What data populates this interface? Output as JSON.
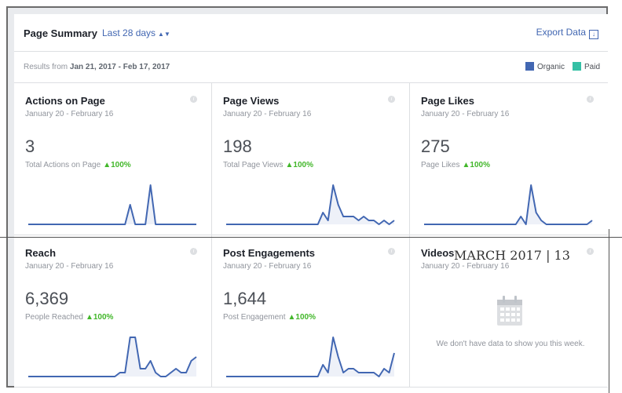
{
  "header": {
    "title": "Page Summary",
    "range": "Last 28 days",
    "export_label": "Export Data"
  },
  "subbar": {
    "results_prefix": "Results from",
    "results_range": "Jan 21, 2017 - Feb 17, 2017",
    "legend": [
      {
        "label": "Organic",
        "color": "#4267b2"
      },
      {
        "label": "Paid",
        "color": "#35c0a5"
      }
    ]
  },
  "cards": [
    {
      "title": "Actions on Page",
      "date": "January 20 - February 16",
      "value": "3",
      "caption": "Total Actions on Page",
      "change": "▲100%",
      "spark": [
        0,
        0,
        0,
        0,
        0,
        0,
        0,
        0,
        0,
        0,
        0,
        0,
        0,
        0,
        0,
        0,
        0,
        0,
        0,
        0,
        1,
        0,
        0,
        0,
        2,
        0,
        0,
        0,
        0,
        0,
        0,
        0,
        0,
        0
      ]
    },
    {
      "title": "Page Views",
      "date": "January 20 - February 16",
      "value": "198",
      "caption": "Total Page Views",
      "change": "▲100%",
      "spark": [
        0,
        0,
        0,
        0,
        0,
        0,
        0,
        0,
        0,
        0,
        0,
        0,
        0,
        0,
        0,
        0,
        0,
        0,
        0,
        3,
        1,
        10,
        5,
        2,
        2,
        2,
        1,
        2,
        1,
        1,
        0,
        1,
        0,
        1
      ]
    },
    {
      "title": "Page Likes",
      "date": "January 20 - February 16",
      "value": "275",
      "caption": "Page Likes",
      "change": "▲100%",
      "spark": [
        0,
        0,
        0,
        0,
        0,
        0,
        0,
        0,
        0,
        0,
        0,
        0,
        0,
        0,
        0,
        0,
        0,
        0,
        0,
        2,
        0,
        10,
        3,
        1,
        0,
        0,
        0,
        0,
        0,
        0,
        0,
        0,
        0,
        1
      ]
    },
    {
      "title": "Reach",
      "date": "January 20 - February 16",
      "value": "6,369",
      "caption": "People Reached",
      "change": "▲100%",
      "spark": [
        0,
        0,
        0,
        0,
        0,
        0,
        0,
        0,
        0,
        0,
        0,
        0,
        0,
        0,
        0,
        0,
        0,
        0,
        1,
        1,
        10,
        10,
        2,
        2,
        4,
        1,
        0,
        0,
        1,
        2,
        1,
        1,
        4,
        5
      ]
    },
    {
      "title": "Post Engagements",
      "date": "January 20 - February 16",
      "value": "1,644",
      "caption": "Post Engagement",
      "change": "▲100%",
      "spark": [
        0,
        0,
        0,
        0,
        0,
        0,
        0,
        0,
        0,
        0,
        0,
        0,
        0,
        0,
        0,
        0,
        0,
        0,
        0,
        3,
        1,
        10,
        5,
        1,
        2,
        2,
        1,
        1,
        1,
        1,
        0,
        2,
        1,
        6
      ]
    },
    {
      "title": "Videos",
      "date": "January 20 - February 16",
      "empty_message": "We don't have data to show you this week."
    }
  ],
  "overlay_text": "MARCH 2017   |   13"
}
